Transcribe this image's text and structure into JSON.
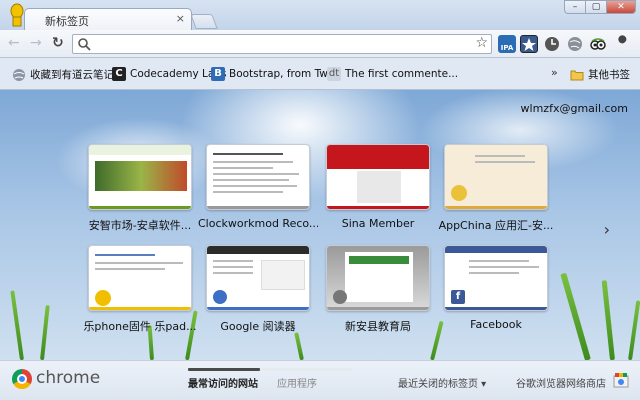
{
  "window": {
    "tab_title": "新标签页",
    "tab_close": "×",
    "controls": [
      "–",
      "▢",
      "✕"
    ]
  },
  "toolbar": {
    "back": "←",
    "forward": "→",
    "reload": "↻",
    "star": "☆"
  },
  "bookmarks": {
    "items": [
      {
        "label": "收藏到有道云笔记",
        "icon": "globe-icon"
      },
      {
        "label": "Codecademy Labs",
        "icon": "codecademy-icon"
      },
      {
        "label": "Bootstrap, from Twi...",
        "icon": "bootstrap-icon"
      },
      {
        "label": "The first commente...",
        "icon": "dt-icon"
      }
    ],
    "overflow": "»",
    "other_label": "其他书签"
  },
  "ntp": {
    "account": "wlmzfx@gmail.com",
    "tiles": [
      {
        "label": "安智市场-安卓软件...",
        "accent": "#6a9a1f"
      },
      {
        "label": "Clockworkmod Reco...",
        "accent": "#777777"
      },
      {
        "label": "Sina Member",
        "accent": "#c4161c"
      },
      {
        "label": "AppChina 应用汇-安...",
        "accent": "#e0a93a"
      },
      {
        "label": "乐phone固件 乐pad...",
        "accent": "#f0c000"
      },
      {
        "label": "Google 阅读器",
        "accent": "#3d6fc4"
      },
      {
        "label": "新安县教育局",
        "accent": "#9a9a9a"
      },
      {
        "label": "Facebook",
        "accent": "#3b5998"
      }
    ],
    "next": "›"
  },
  "footer": {
    "brand": "chrome",
    "tab_most_visited": "最常访问的网站",
    "tab_apps": "应用程序",
    "recently_closed": "最近关闭的标签页 ▾",
    "store": "谷歌浏览器网络商店"
  }
}
